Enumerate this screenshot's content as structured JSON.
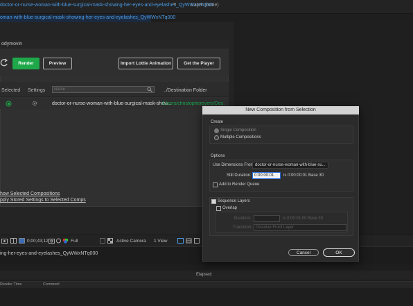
{
  "tabs": {
    "comp_tab": "doctor-or-nurse-woman-with-blue-surgical-mask-showing-her-eyes-and-eyelashes_QyWWxNTq000",
    "comp_menu": "≡",
    "layer_tab": "Layer (none)",
    "comp_subtab": "oman-with-blue-surgical-mask-showing-her-eyes-and-eyelashes_QyWWxNTq000"
  },
  "bodymovin": {
    "title": "odymovin",
    "render_label": "Render",
    "preview_label": "Preview",
    "import_label": "Import Lottie Animation",
    "player_label": "Get the Player",
    "col_selected": "Selected",
    "col_settings": "Settings",
    "search_placeholder": "Name",
    "col_destination": "../Destination Folder",
    "row_name": "doctor-or-nurse-woman-with-blue-surgical-mask-show...",
    "row_destination": "/Users/christophereyers/Des...",
    "link_show_selected": "how Selected Compositions",
    "link_apply_settings": "pply Stored Settings to Selected Comps"
  },
  "viewer_controls": {
    "timecode": "0;00;43;12",
    "resolution": "Full",
    "camera": "Active Camera",
    "view": "1 View"
  },
  "timeline": {
    "tab_label": "ing-her-eyes-and-eyelashes_QyWWxNTq000",
    "elapsed_label": "Elapsed:",
    "col_render_time": "Render Time",
    "col_comment": "Comment"
  },
  "dialog": {
    "title": "New Composition from Selection",
    "create_section": "Create",
    "single_comp": "Single Composition",
    "multiple_comps": "Multiple Compositions",
    "options_section": "Options",
    "use_dims_label": "Use Dimensions From:",
    "use_dims_value": "doctor-or-nurse-woman-with-blue-su...",
    "still_label": "Still Duration:",
    "still_value": "0:00:00:01",
    "still_info": "is 0:00:00:01  Base 30",
    "add_render_queue": "Add to Render Queue",
    "sequence_layers": "Sequence Layers",
    "overlap": "Overlap",
    "duration_label": "Duration:",
    "duration_info": "is 0:00:01:00  Base 30",
    "transition_label": "Transition:",
    "transition_value": "Dissolve Front Layer",
    "cancel_label": "Cancel",
    "ok_label": "OK"
  },
  "colors": {
    "accent_blue": "#4b9be6",
    "render_green": "#1ea84a",
    "dest_green": "#18a44c"
  }
}
